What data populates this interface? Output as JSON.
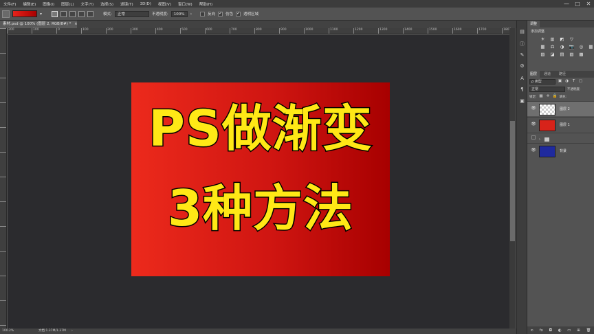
{
  "menu": [
    "文件(F)",
    "编辑(E)",
    "图像(I)",
    "图层(L)",
    "文字(Y)",
    "选择(S)",
    "滤镜(T)",
    "3D(D)",
    "视图(V)",
    "窗口(W)",
    "帮助(H)"
  ],
  "window_controls": [
    "—",
    "□",
    "✕"
  ],
  "options": {
    "mode_label": "模式:",
    "mode_value": "正常",
    "opacity_label": "不透明度:",
    "opacity_value": "100%",
    "reverse_label": "反向",
    "dither_label": "仿色",
    "transparency_label": "透明区域",
    "reverse_checked": false,
    "dither_checked": true,
    "transparency_checked": true,
    "gradient_colors": [
      "#e8231b",
      "#a80000"
    ]
  },
  "document": {
    "tab_title": "素材.psd @ 100% (图层 2, RGB/8#) *",
    "close": "×"
  },
  "ruler_ticks": [
    "200",
    "100",
    "0",
    "100",
    "200",
    "300",
    "400",
    "500",
    "600",
    "700",
    "800",
    "900",
    "1000",
    "1100",
    "1200",
    "1300",
    "1400",
    "1500",
    "1600",
    "1700",
    "1800",
    "1900"
  ],
  "canvas": {
    "line1": "PS做渐变",
    "line2": "3种方法",
    "text_color": "#ffe816",
    "bg_colors": [
      "#ec2a1c",
      "#a70000"
    ]
  },
  "status": {
    "zoom": "100.2%",
    "doc": "文档:1.37M/1.37M",
    "arrow": "›"
  },
  "adjustments": {
    "tab": "调整",
    "title": "添加调整",
    "icons": [
      "☀",
      "▥",
      "◩",
      "▽",
      "",
      "",
      "▦",
      "⚖",
      "◑",
      "📷",
      "◎",
      "▦",
      "▨",
      "◪",
      "▤",
      "▧",
      "▩",
      ""
    ]
  },
  "layers_panel": {
    "tabs": [
      "图层",
      "通道",
      "路径"
    ],
    "kind_label": "ρ 类型",
    "blend_mode": "正常",
    "opacity_label": "不透明度:",
    "opacity_value": "100%",
    "lock_label": "锁定:",
    "fill_label": "填充:",
    "fill_value": "100%",
    "layers": [
      {
        "name": "图层 2",
        "visible": true,
        "selected": true,
        "thumb": "transparent"
      },
      {
        "name": "图层 1",
        "visible": true,
        "selected": false,
        "thumb": "#d8231a"
      },
      {
        "name": "",
        "visible": false,
        "selected": false,
        "thumb": "group"
      },
      {
        "name": "背景",
        "visible": true,
        "selected": false,
        "thumb": "#1f2a9e"
      }
    ],
    "footer_icons": [
      "∞",
      "fx",
      "◘",
      "◐",
      "▭",
      "⊞",
      "🗑"
    ]
  }
}
